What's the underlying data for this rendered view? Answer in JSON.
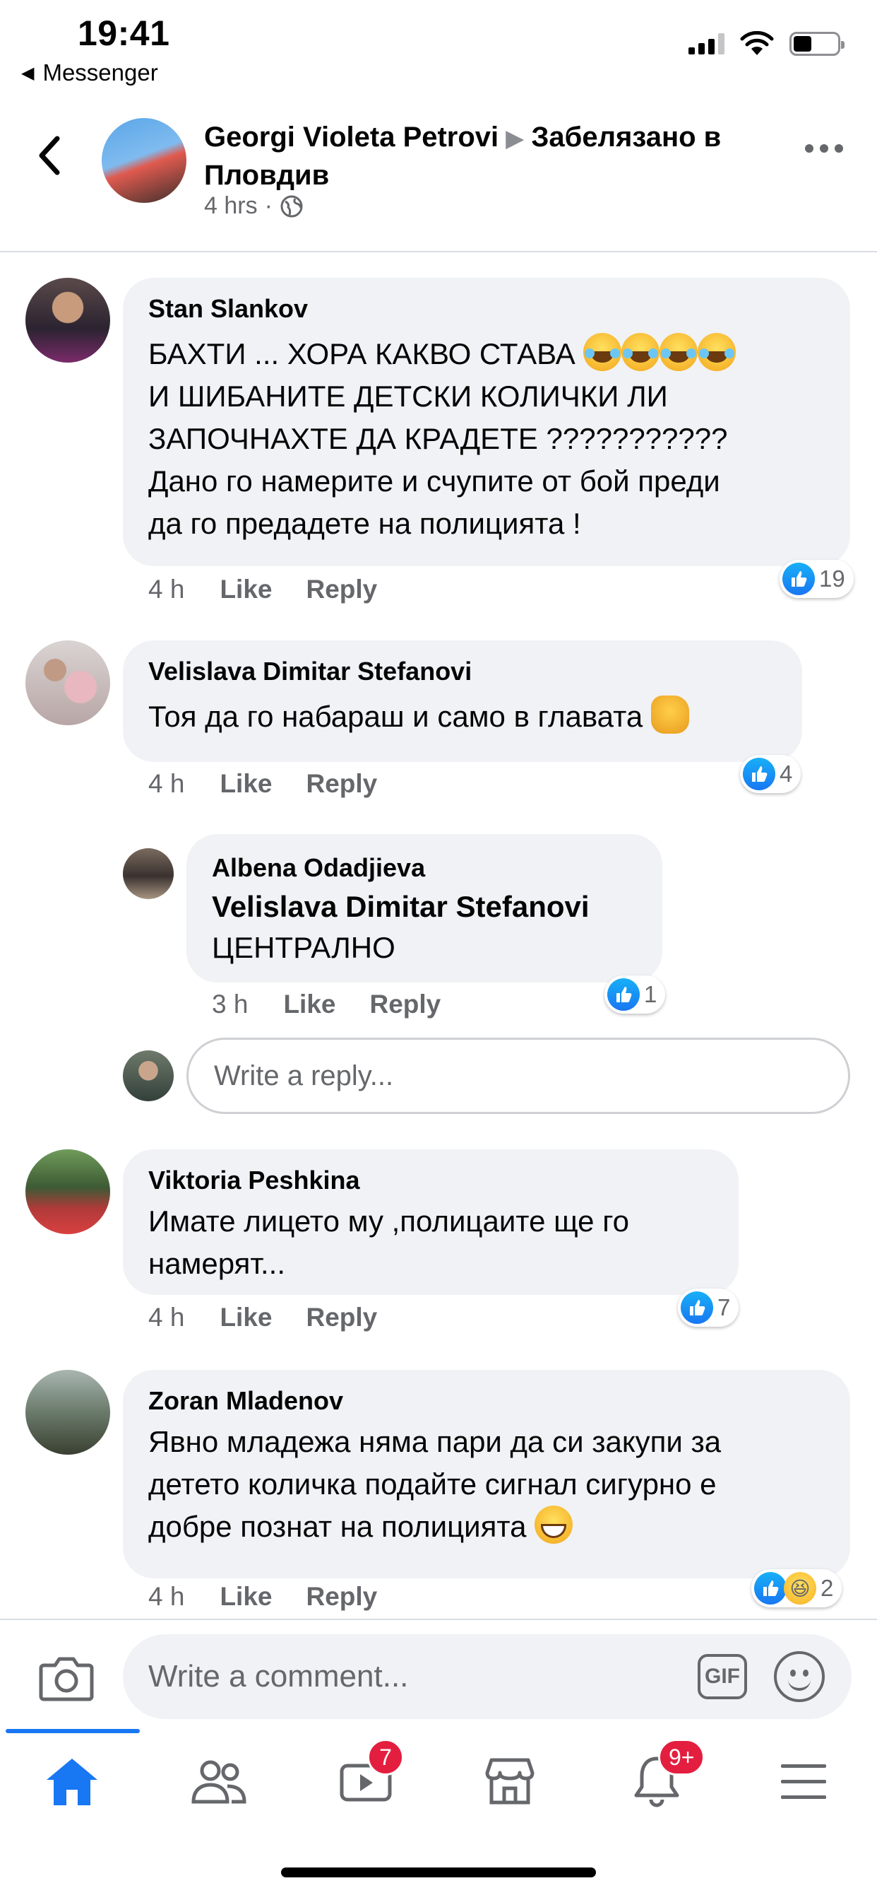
{
  "status_bar": {
    "time": "19:41",
    "back_app": "Messenger"
  },
  "post_header": {
    "author": "Georgi Violeta Petrovi",
    "separator": "▶",
    "location": "Забелязано в Пловдив",
    "time": "4 hrs",
    "audience_icon": "globe-icon"
  },
  "comments": [
    {
      "name": "Stan Slankov",
      "text": "БАХТИ ... ХОРА КАКВО СТАВА",
      "text_lines": [
        "И ШИБАНИТЕ ДЕТСКИ КОЛИЧКИ ЛИ",
        "ЗАПОЧНАХТЕ ДА КРАДЕТЕ ???????????",
        "Дано го намерите и счупите от бой преди",
        "да го предадете на полицията !"
      ],
      "emoji": "face-with-tears-of-joy x4",
      "time": "4 h",
      "like": "Like",
      "reply": "Reply",
      "reaction_count": "19"
    },
    {
      "name": "Velislava Dimitar Stefanovi",
      "text": "Тоя да го набараш и само в главата",
      "emoji": "oncoming-fist",
      "time": "4 h",
      "like": "Like",
      "reply": "Reply",
      "reaction_count": "4"
    },
    {
      "name": "Albena Odadjieva",
      "mention": "Velislava Dimitar Stefanovi",
      "text": "ЦЕНТРАЛНО",
      "time": "3 h",
      "like": "Like",
      "reply": "Reply",
      "reaction_count": "1"
    },
    {
      "name": "Viktoria Peshkina",
      "text_lines": [
        "Имате лицето му ,полицаите ще го",
        "намерят..."
      ],
      "time": "4 h",
      "like": "Like",
      "reply": "Reply",
      "reaction_count": "7"
    },
    {
      "name": "Zoran Mladenov",
      "text_lines": [
        "Явно младежа няма пари да си закупи за",
        "детето количка подайте сигнал сигурно е",
        "добре познат на полицията"
      ],
      "emoji": "grinning-face",
      "time": "4 h",
      "like": "Like",
      "reply": "Reply",
      "reaction_count": "2"
    }
  ],
  "reply_input": {
    "placeholder": "Write a reply..."
  },
  "composer": {
    "placeholder": "Write a comment...",
    "gif_label": "GIF"
  },
  "tab_bar": {
    "tabs": [
      "home",
      "friends",
      "watch",
      "marketplace",
      "notifications",
      "menu"
    ],
    "watch_badge": "7",
    "notifications_badge": "9+",
    "active": "home"
  },
  "colors": {
    "accent": "#1877f2",
    "bubble": "#f0f2f5",
    "badge": "#e41e3f",
    "secondary_text": "#65676b"
  }
}
